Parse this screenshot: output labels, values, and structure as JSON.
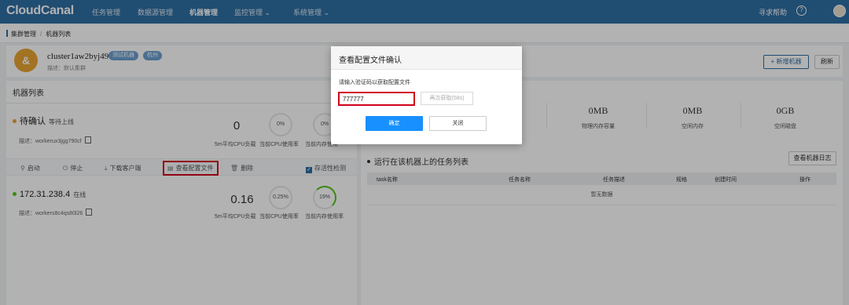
{
  "app": {
    "logo": "CloudCanal"
  },
  "nav": {
    "items": [
      "任务管理",
      "数据源管理",
      "机器管理",
      "监控管理 ⌄",
      "系统管理 ⌄"
    ],
    "help": "寻求帮助",
    "help_icon": "?"
  },
  "breadcrumb": {
    "parent": "集群管理",
    "sep": "/",
    "current": "机器列表"
  },
  "cluster": {
    "avatar_letter": "&",
    "name": "cluster1aw2byj490",
    "tag1": "测试机器",
    "tag2": "杭州",
    "desc": "描述：默认集群",
    "add_btn": "+ 新增机器",
    "refresh_btn": "刷新"
  },
  "machine_list": {
    "title": "机器列表",
    "machines": [
      {
        "name": "待确认",
        "status": "等待上线",
        "status_color": "#e8a531",
        "desc": "描述：workerux3jgg790cf",
        "cpu_load": "0",
        "cpu_load_label": "5m平均CPU负载",
        "cpu_usage": "0%",
        "cpu_usage_label": "当前CPU使用率",
        "mem_usage": "0%",
        "mem_usage_label": "当前内存使用"
      },
      {
        "name": "172.31.238.4",
        "status": "在线",
        "status_color": "#52c41a",
        "desc": "描述：workers8c4qs80l26",
        "cpu_load": "0.16",
        "cpu_load_label": "5m平均CPU负载",
        "cpu_usage": "0.25%",
        "cpu_usage_label": "当前CPU使用率",
        "mem_usage": "19%",
        "mem_usage_label": "当前内存使用率"
      }
    ],
    "actions": {
      "start": "启动",
      "stop": "停止",
      "download": "下载客户端",
      "view_config": "查看配置文件",
      "delete": "删除",
      "health_check": "存活性检测"
    }
  },
  "stats": {
    "phys_mem": "0MB",
    "phys_mem_label": "物理内存容量",
    "free_mem": "0MB",
    "free_mem_label": "空闲内存",
    "free_disk": "0GB",
    "free_disk_label": "空闲磁盘"
  },
  "tasks": {
    "title": "运行在该机器上的任务列表",
    "log_btn": "查看机器日志",
    "columns": [
      "task名称",
      "任务名称",
      "任务描述",
      "规格",
      "创建时间",
      "操作"
    ],
    "empty": "暂无数据"
  },
  "modal": {
    "title": "查看配置文件确认",
    "prompt": "请输入验证码以获取配置文件",
    "code_value": "777777",
    "resend": "再次获取(58s)",
    "ok": "确定",
    "close": "关闭"
  }
}
